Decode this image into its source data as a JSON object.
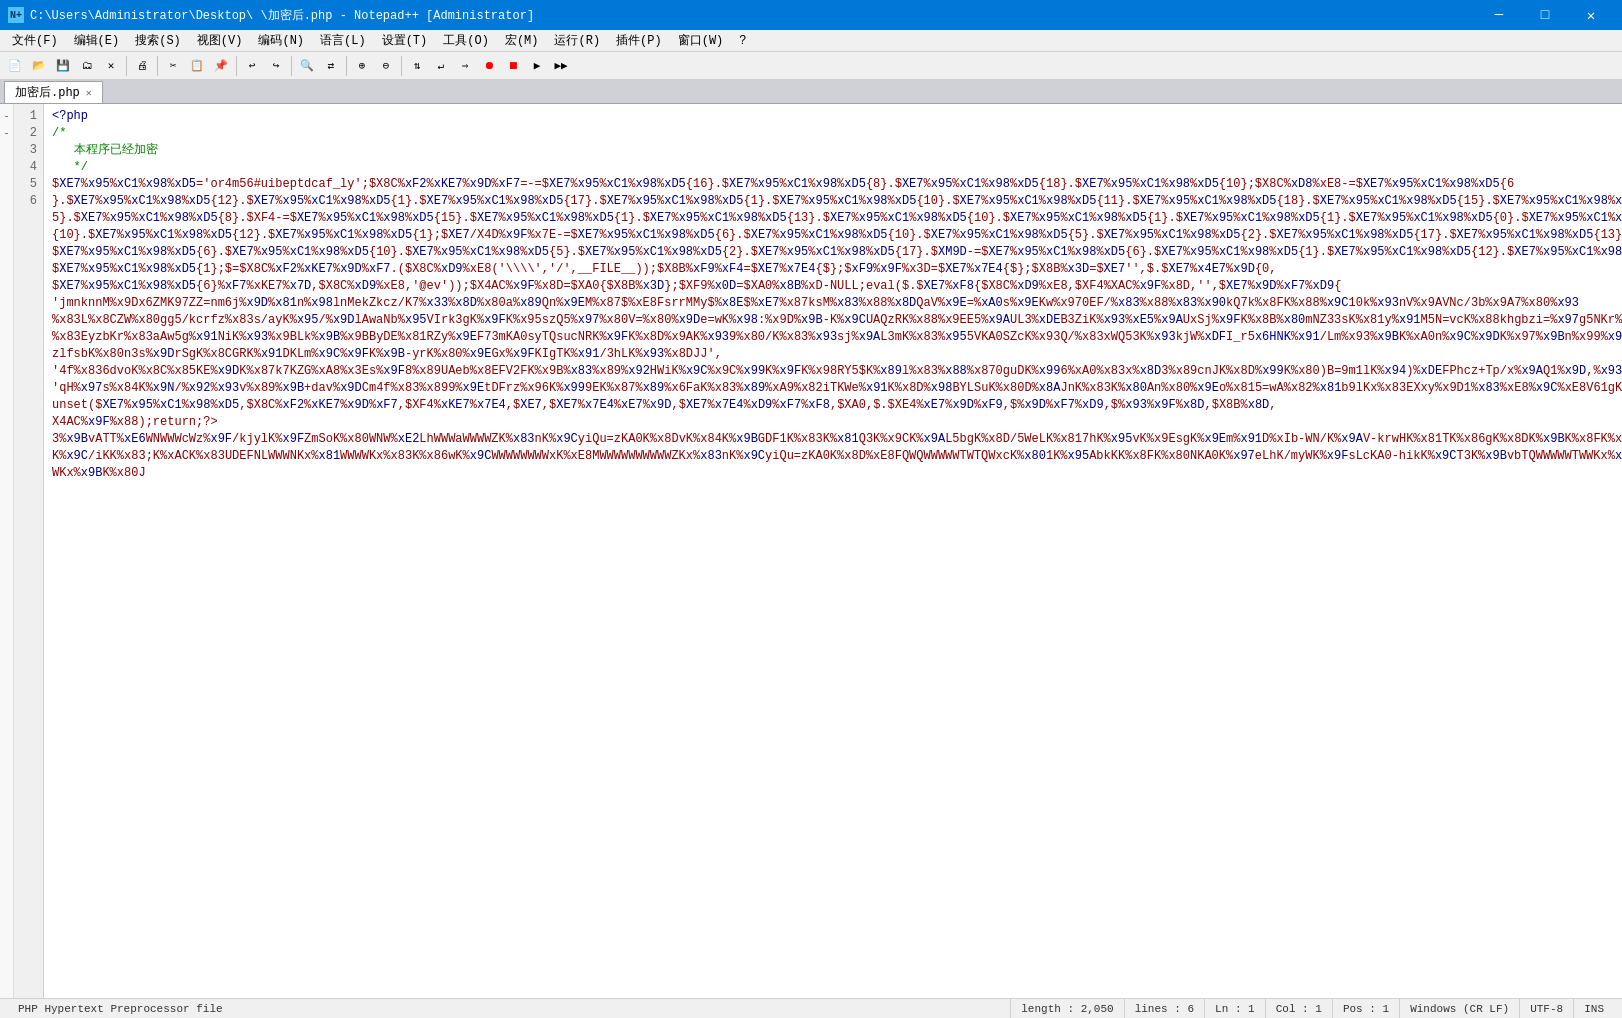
{
  "titlebar": {
    "title": "C:\\Users\\Administrator\\Desktop\\          \\加密后.php - Notepad++ [Administrator]",
    "icon_text": "N+",
    "minimize_btn": "─",
    "maximize_btn": "□",
    "close_btn": "✕"
  },
  "menubar": {
    "items": [
      "文件(F)",
      "编辑(E)",
      "搜索(S)",
      "视图(V)",
      "编码(N)",
      "语言(L)",
      "设置(T)",
      "工具(O)",
      "宏(M)",
      "运行(R)",
      "插件(P)",
      "窗口(W)",
      "?"
    ]
  },
  "tabs": [
    {
      "label": "加密后.php",
      "active": true
    }
  ],
  "editor": {
    "line_numbers": [
      "1",
      "2",
      "3",
      "4",
      "5",
      "6"
    ],
    "fold_markers": [
      "-",
      "-",
      " ",
      " ",
      " ",
      " "
    ]
  },
  "status": {
    "file_type": "PHP Hypertext Preprocessor file",
    "length": "length : 2,050",
    "lines": "lines : 6",
    "ln": "Ln : 1",
    "col": "Col : 1",
    "pos": "Pos : 1",
    "line_ending": "Windows (CR LF)",
    "encoding": "UTF-8",
    "ins": "INS"
  }
}
